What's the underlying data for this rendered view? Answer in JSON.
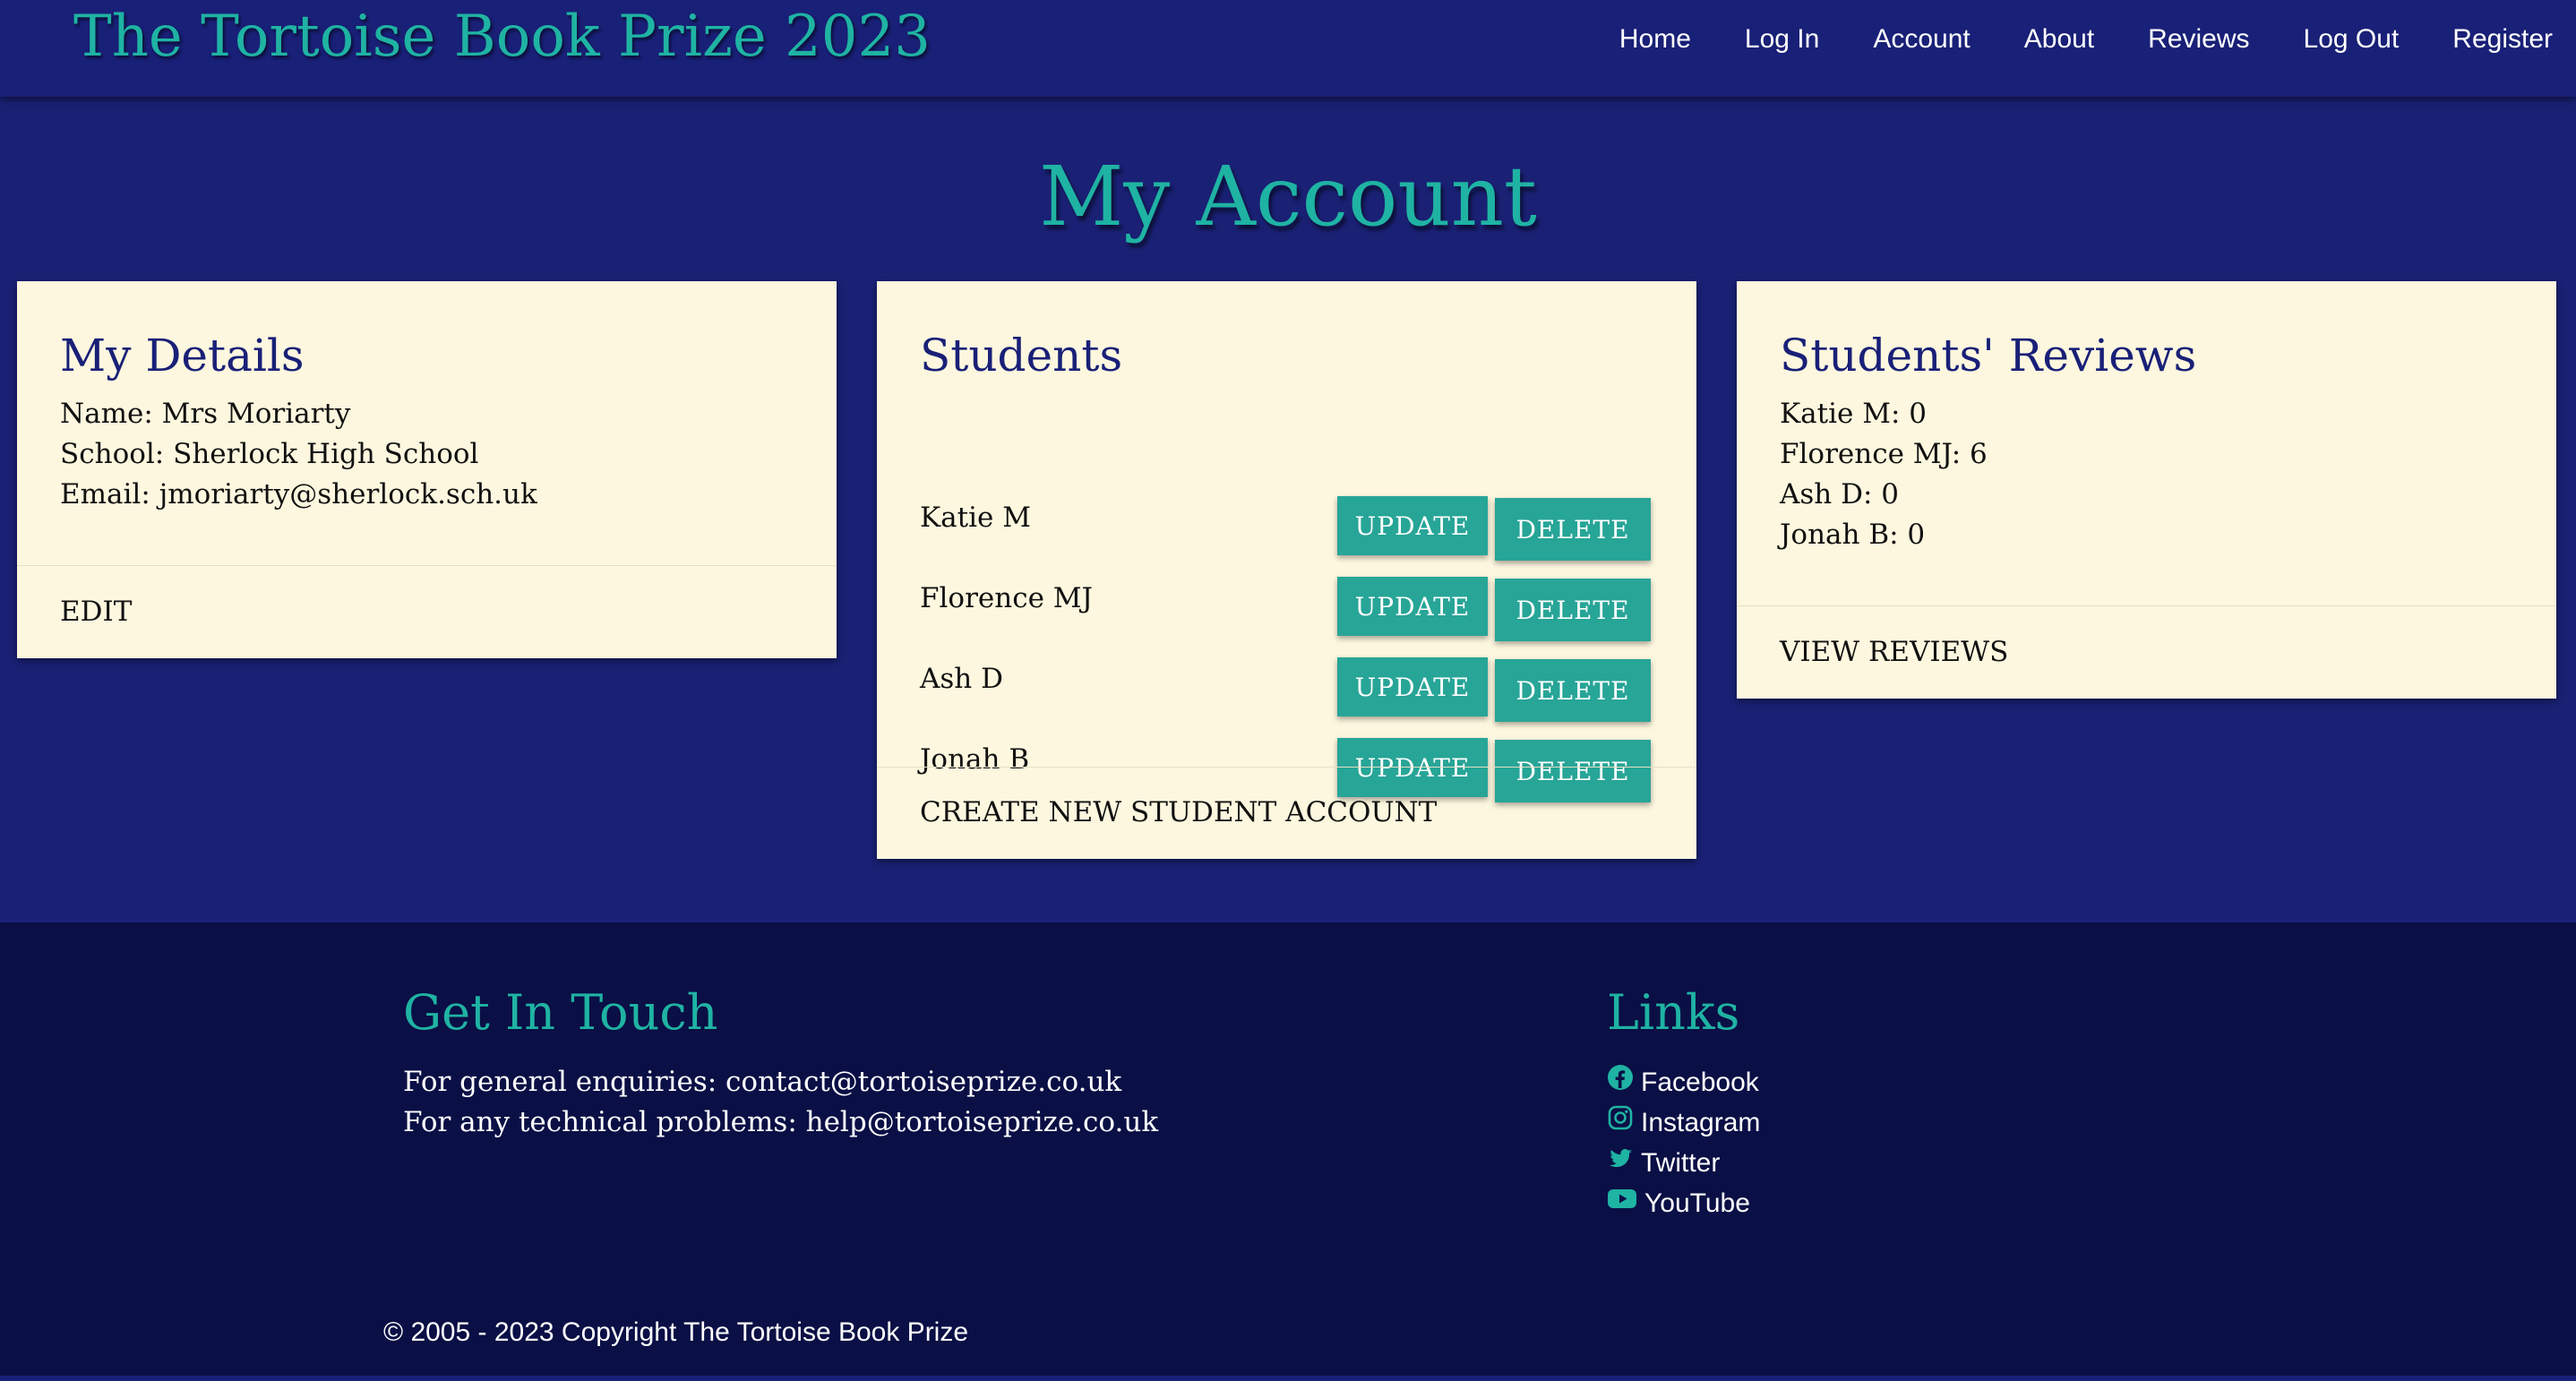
{
  "brand": "The Tortoise Book Prize 2023",
  "nav": {
    "items": [
      {
        "label": "Home"
      },
      {
        "label": "Log In"
      },
      {
        "label": "Account"
      },
      {
        "label": "About"
      },
      {
        "label": "Reviews"
      },
      {
        "label": "Log Out"
      },
      {
        "label": "Register"
      }
    ]
  },
  "page_title": "My Account",
  "details_card": {
    "title": "My Details",
    "name_line": "Name: Mrs Moriarty",
    "school_line": "School: Sherlock High School",
    "email_line": "Email: jmoriarty@sherlock.sch.uk",
    "action": "EDIT"
  },
  "students_card": {
    "title": "Students",
    "students": [
      {
        "name": "Katie M"
      },
      {
        "name": "Florence MJ"
      },
      {
        "name": "Ash D"
      },
      {
        "name": "Jonah B"
      }
    ],
    "update_label": "UPDATE",
    "delete_label": "DELETE",
    "action": "CREATE NEW STUDENT ACCOUNT"
  },
  "reviews_card": {
    "title": "Students' Reviews",
    "counts": [
      {
        "text": "Katie M: 0"
      },
      {
        "text": "Florence MJ: 6"
      },
      {
        "text": "Ash D: 0"
      },
      {
        "text": "Jonah B: 0"
      }
    ],
    "action": "VIEW REVIEWS"
  },
  "footer": {
    "contact_heading": "Get In Touch",
    "general_line": "For general enquiries: contact@tortoiseprize.co.uk",
    "technical_line": "For any technical problems: help@tortoiseprize.co.uk",
    "links_heading": "Links",
    "links": [
      {
        "label": "Facebook",
        "icon": "facebook-icon"
      },
      {
        "label": "Instagram",
        "icon": "instagram-icon"
      },
      {
        "label": "Twitter",
        "icon": "twitter-icon"
      },
      {
        "label": "YouTube",
        "icon": "youtube-icon"
      }
    ],
    "copyright": "© 2005 - 2023 Copyright The Tortoise Book Prize"
  },
  "colors": {
    "navy": "#1a2175",
    "footer_navy": "#0a0f45",
    "teal": "#1fb3a3",
    "button_teal": "#27a597",
    "card_cream": "#fdf7df"
  }
}
